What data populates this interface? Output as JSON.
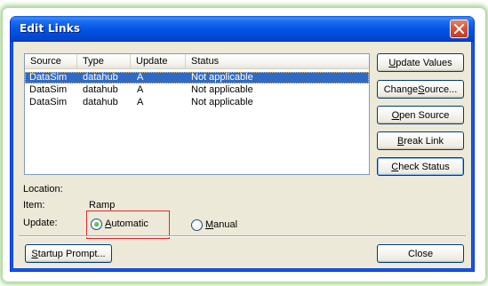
{
  "window": {
    "title": "Edit Links"
  },
  "list": {
    "columns": [
      "Source",
      "Type",
      "Update",
      "Status"
    ],
    "rows": [
      {
        "source": "DataSim",
        "type": "datahub",
        "update": "A",
        "status": "Not applicable",
        "selected": true
      },
      {
        "source": "DataSim",
        "type": "datahub",
        "update": "A",
        "status": "Not applicable",
        "selected": false
      },
      {
        "source": "DataSim",
        "type": "datahub",
        "update": "A",
        "status": "Not applicable",
        "selected": false
      }
    ]
  },
  "buttons": {
    "update_values": {
      "pre": "",
      "key": "U",
      "post": "pdate Values"
    },
    "change_source": {
      "pre": "Change ",
      "key": "S",
      "post": "ource..."
    },
    "open_source": {
      "pre": "",
      "key": "O",
      "post": "pen Source"
    },
    "break_link": {
      "pre": "",
      "key": "B",
      "post": "reak Link"
    },
    "check_status": {
      "pre": "",
      "key": "C",
      "post": "heck Status"
    },
    "startup_prompt": {
      "pre": "",
      "key": "S",
      "post": "tartup Prompt..."
    },
    "close": {
      "label": "Close"
    }
  },
  "details": {
    "location_label": "Location:",
    "location_value": "",
    "item_label": "Item:",
    "item_value": "Ramp",
    "update_label": "Update:"
  },
  "update_mode": {
    "automatic": {
      "key": "A",
      "post": "utomatic",
      "checked": true
    },
    "manual": {
      "key": "M",
      "post": "anual",
      "checked": false
    }
  },
  "colors": {
    "title_bar": "#0055e5",
    "selection": "#316ac5",
    "highlight_box": "#e0272b",
    "dialog_bg": "#ece9d8"
  }
}
